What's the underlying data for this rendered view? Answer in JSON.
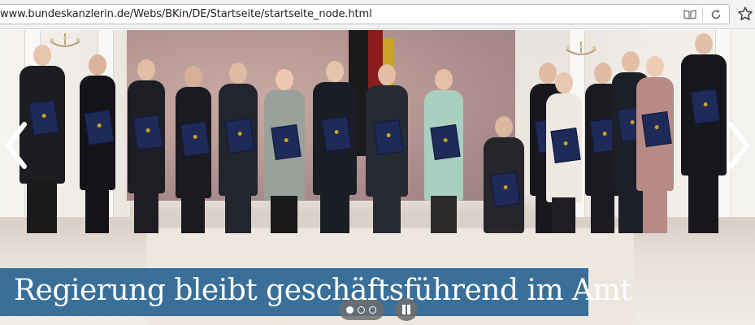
{
  "browser": {
    "url": "www.bundeskanzlerin.de/Webs/BKin/DE/Startseite/startseite_node.html",
    "icons": [
      "reader-view-icon",
      "reload-icon",
      "bookmark-star-icon"
    ]
  },
  "slider": {
    "caption": "Regierung bleibt geschäftsführend im Amt",
    "caption_bg": "#296591",
    "slide_count": 3,
    "active_slide": 1,
    "icons": [
      "chevron-left-icon",
      "chevron-right-icon",
      "pause-icon"
    ]
  }
}
